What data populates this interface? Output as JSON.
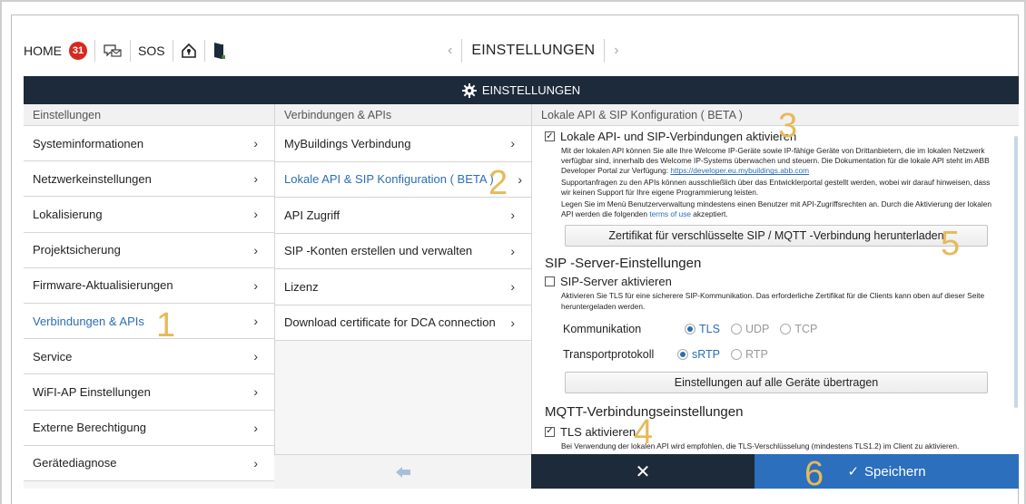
{
  "topbar": {
    "home_label": "HOME",
    "notification_count": "31",
    "sos_label": "SOS",
    "title": "EINSTELLUNGEN",
    "prev_icon": "chevron-left-icon",
    "next_icon": "chevron-right-icon"
  },
  "header": {
    "icon": "gear-icon",
    "title": "EINSTELLUNGEN"
  },
  "left_pane": {
    "heading": "Einstellungen",
    "items": [
      {
        "label": "Systeminformationen"
      },
      {
        "label": "Netzwerkeinstellungen"
      },
      {
        "label": "Lokalisierung"
      },
      {
        "label": "Projektsicherung"
      },
      {
        "label": "Firmware-Aktualisierungen"
      },
      {
        "label": "Verbindungen & APIs"
      },
      {
        "label": "Service"
      },
      {
        "label": "WiFI-AP Einstellungen"
      },
      {
        "label": "Externe Berechtigung"
      },
      {
        "label": "Gerätediagnose"
      }
    ]
  },
  "middle_pane": {
    "heading": "Verbindungen & APIs",
    "items": [
      {
        "label": "MyBuildings Verbindung"
      },
      {
        "label": "Lokale API & SIP Konfiguration ( BETA )"
      },
      {
        "label": "API Zugriff"
      },
      {
        "label": "SIP -Konten erstellen und verwalten"
      },
      {
        "label": "Lizenz"
      },
      {
        "label": "Download certificate for DCA connection"
      }
    ]
  },
  "right_pane": {
    "heading": "Lokale API & SIP Konfiguration ( BETA )",
    "local_api_checkbox": "Lokale API- und SIP-Verbindungen aktivieren",
    "local_api_text_1": "Mit der lokalen API können Sie alle Ihre Welcome IP-Geräte sowie IP-fähige Geräte von Drittanbietern, die im lokalen Netzwerk verfügbar sind, innerhalb des Welcome IP-Systems überwachen und steuern. Die Dokumentation für die lokale API steht im ABB Developer Portal zur Verfügung: ",
    "local_api_link": "https://developer.eu.mybuildings.abb.com",
    "local_api_text_2": "Supportanfragen zu den APIs können ausschließlich über das Entwicklerportal gestellt werden, wobei wir darauf hinweisen, dass wir keinen Support für Ihre eigene Programmierung leisten.",
    "local_api_text_3": "Legen Sie im Menü Benutzerverwaltung mindestens einen Benutzer mit API-Zugriffsrechten an. Durch die Aktivierung der lokalen API werden die folgenden ",
    "terms_link": "terms of use",
    "local_api_text_4": " akzeptiert.",
    "cert_button": "Zertifikat für verschlüsselte SIP / MQTT -Verbindung herunterladen",
    "sip_heading": "SIP -Server-Einstellungen",
    "sip_checkbox": "SIP-Server aktivieren",
    "sip_text": "Aktivieren Sie TLS für eine sicherere SIP-Kommunikation. Das erforderliche Zertifikat für die Clients kann oben auf dieser Seite heruntergeladen werden.",
    "komm_label": "Kommunikation",
    "komm_options": [
      "TLS",
      "UDP",
      "TCP"
    ],
    "transport_label": "Transportprotokoll",
    "transport_options": [
      "sRTP",
      "RTP"
    ],
    "apply_button": "Einstellungen auf alle Geräte übertragen",
    "mqtt_heading": "MQTT-Verbindungseinstellungen",
    "tls_checkbox": "TLS aktivieren",
    "mqtt_text": "Bei Verwendung der lokalen API wird empfohlen, die TLS-Verschlüsselung (mindestens TLS1.2) im Client zu aktivieren."
  },
  "bottom": {
    "back_icon": "back-arrow-icon",
    "cancel_icon": "close-icon",
    "save_label": "Speichern"
  },
  "annotations": [
    "1",
    "2",
    "3",
    "4",
    "5",
    "6"
  ],
  "colors": {
    "dark_header": "#1d2a39",
    "accent_blue": "#2b6fbd",
    "annotation": "#e7b95b",
    "badge_red": "#d62a1f"
  }
}
